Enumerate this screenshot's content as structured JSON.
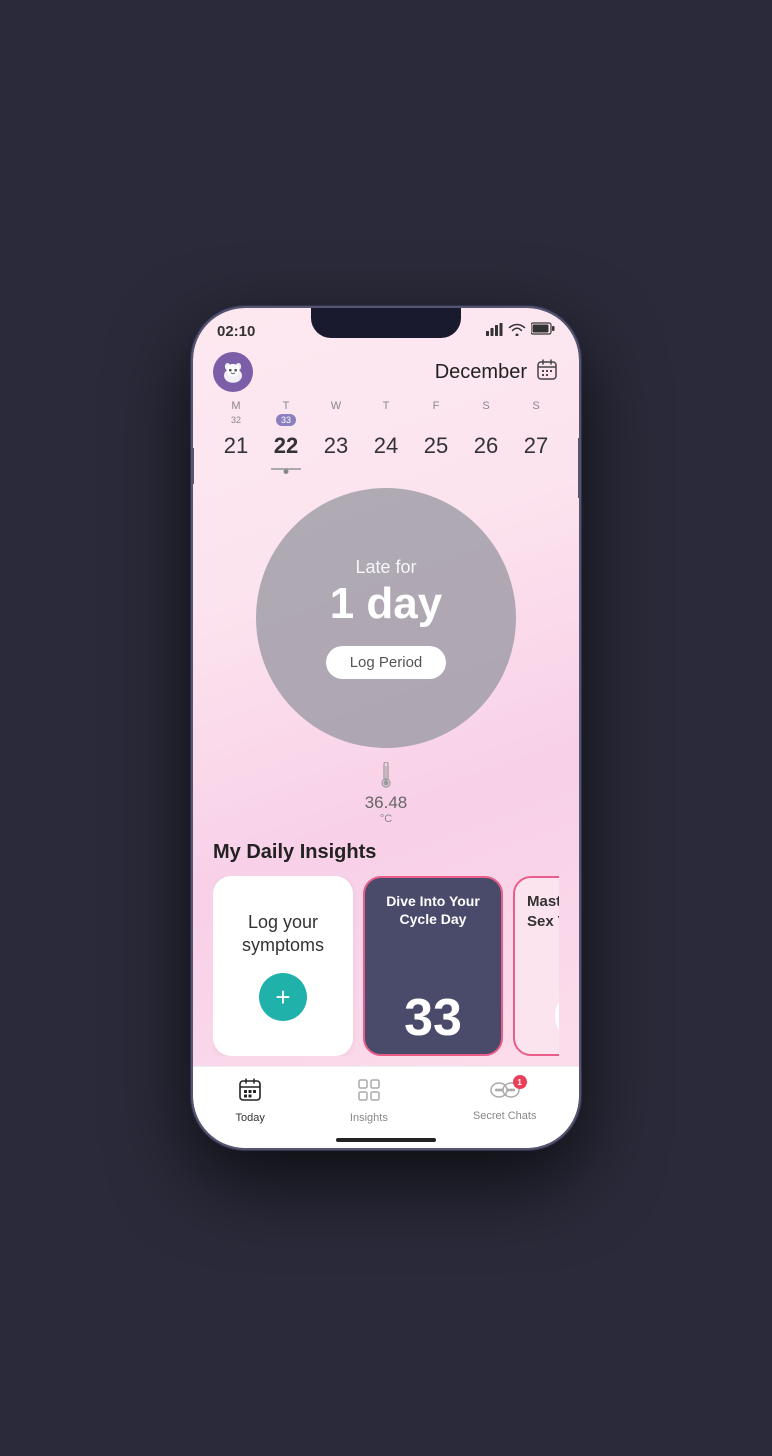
{
  "statusBar": {
    "time": "02:10"
  },
  "header": {
    "month": "December",
    "calendarIconLabel": "calendar"
  },
  "weekCalendar": {
    "dayLabels": [
      "M",
      "T",
      "W",
      "T",
      "F",
      "S",
      "S"
    ],
    "dates": [
      21,
      22,
      23,
      24,
      25,
      26,
      27
    ],
    "cycleDayBadge": "33",
    "cycleDayPosition": 1,
    "weekNum32": "32",
    "selectedDateIndex": 1
  },
  "cycleStatus": {
    "lateForText": "Late for",
    "daysCount": "1 day",
    "logPeriodLabel": "Log Period"
  },
  "temperature": {
    "value": "36.48",
    "unit": "°C"
  },
  "insights": {
    "title": "My Daily Insights",
    "cards": [
      {
        "id": "log-symptoms",
        "label": "Log your symptoms",
        "addIcon": "+"
      },
      {
        "id": "cycle-day",
        "title": "Dive Into Your Cycle Day",
        "number": "33"
      },
      {
        "id": "healthy-sex",
        "title": "Master Healthy Sex Talk"
      }
    ]
  },
  "bottomNav": {
    "items": [
      {
        "id": "today",
        "label": "Today",
        "icon": "calendar-today",
        "active": true
      },
      {
        "id": "insights",
        "label": "Insights",
        "icon": "grid",
        "active": false
      },
      {
        "id": "secret-chats",
        "label": "Secret Chats",
        "icon": "secret",
        "active": false,
        "badge": "1"
      }
    ]
  }
}
